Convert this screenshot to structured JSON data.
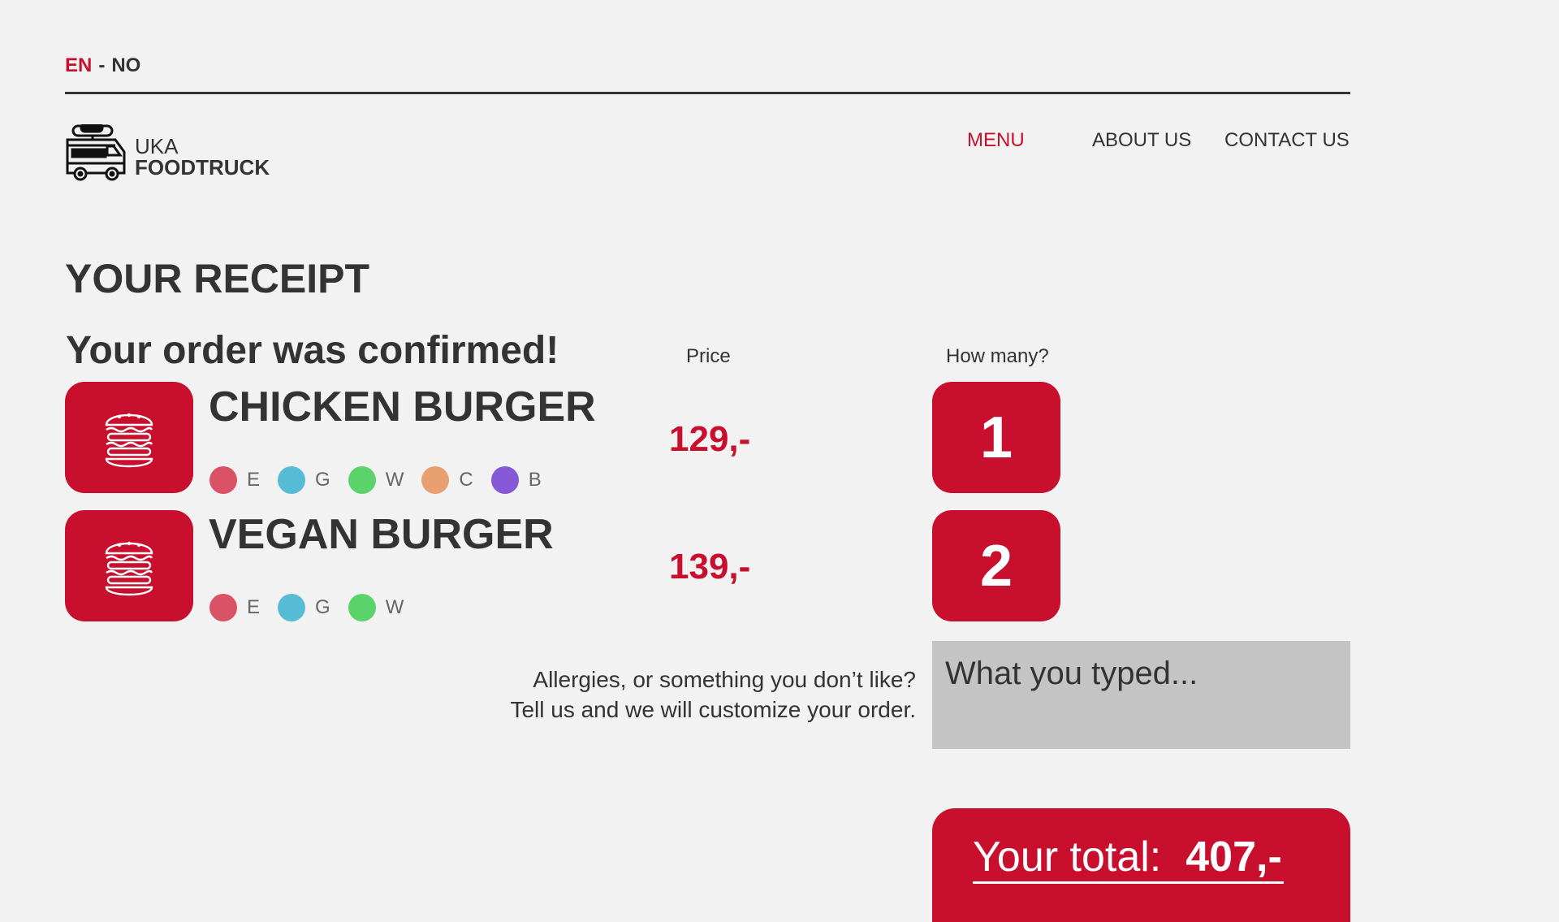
{
  "language": {
    "active": "EN",
    "separator": "-",
    "other": "NO"
  },
  "logo": {
    "line1": "UKA",
    "line2": "FOODTRUCK"
  },
  "nav": {
    "menu": "MENU",
    "about": "ABOUT US",
    "contact": "CONTACT US"
  },
  "page_title": "YOUR RECEIPT",
  "confirmation": "Your order was confirmed!",
  "columns": {
    "price": "Price",
    "quantity": "How many?"
  },
  "items": [
    {
      "name": "CHICKEN BURGER",
      "price": "129,-",
      "quantity": "1",
      "allergens": [
        {
          "code": "E",
          "color": "#d95266"
        },
        {
          "code": "G",
          "color": "#56bcd6"
        },
        {
          "code": "W",
          "color": "#5ad46a"
        },
        {
          "code": "C",
          "color": "#e8a070"
        },
        {
          "code": "B",
          "color": "#8458d6"
        }
      ]
    },
    {
      "name": "VEGAN BURGER",
      "price": "139,-",
      "quantity": "2",
      "allergens": [
        {
          "code": "E",
          "color": "#d95266"
        },
        {
          "code": "G",
          "color": "#56bcd6"
        },
        {
          "code": "W",
          "color": "#5ad46a"
        }
      ]
    }
  ],
  "allergies": {
    "line1": "Allergies, or something you don’t like?",
    "line2": "Tell us and we will customize your order.",
    "placeholder": "What you typed..."
  },
  "total": {
    "label": "Your total:",
    "value": "407,-"
  },
  "colors": {
    "accent": "#c8102e",
    "background": "#f2f2f2",
    "text": "#333333",
    "input_bg": "#c4c4c4"
  }
}
